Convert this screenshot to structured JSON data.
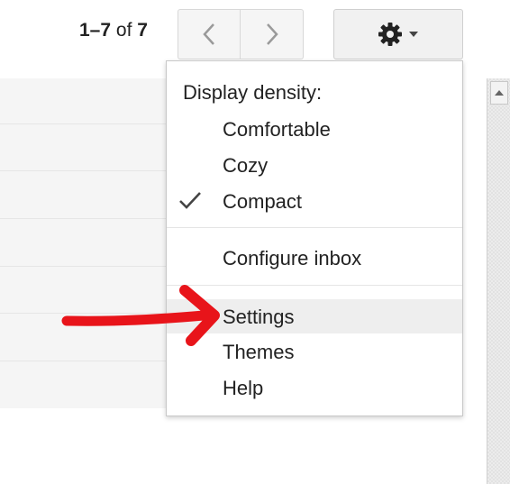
{
  "toolbar": {
    "pager_range": "1–7",
    "pager_of": "of",
    "pager_total": "7",
    "prev_icon": "chevron-left-icon",
    "next_icon": "chevron-right-icon",
    "settings_icon": "gear-icon"
  },
  "menu": {
    "heading": "Display density:",
    "items": [
      {
        "label": "Comfortable",
        "checked": false
      },
      {
        "label": "Cozy",
        "checked": false
      },
      {
        "label": "Compact",
        "checked": true
      },
      {
        "label": "Configure inbox",
        "checked": false
      },
      {
        "label": "Settings",
        "checked": false,
        "highlighted": true
      },
      {
        "label": "Themes",
        "checked": false
      },
      {
        "label": "Help",
        "checked": false
      }
    ]
  },
  "colors": {
    "annotation_arrow": "#e8141a",
    "menu_hover": "#eeeeee"
  }
}
